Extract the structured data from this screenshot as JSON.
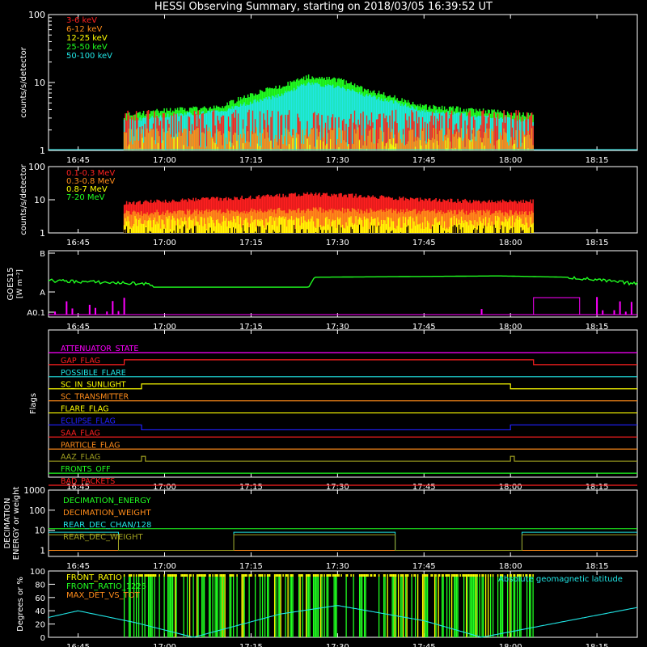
{
  "title": "HESSI Observing Summary, starting on 2018/03/05 16:39:52 UT",
  "x_ticks": [
    "16:45",
    "17:00",
    "17:15",
    "17:30",
    "17:45",
    "18:00",
    "18:15"
  ],
  "colors": {
    "text": "#ffffff",
    "axis": "#ffffff",
    "red": "#ff2020",
    "orange": "#ff8c1a",
    "yellow": "#ffff00",
    "green": "#20ff20",
    "cyan": "#20e6e6",
    "magenta": "#ff00ff",
    "blue": "#2020ff",
    "olive": "#a0a020",
    "gold": "#ffcc33"
  },
  "chart_data": [
    {
      "id": "low-energy",
      "type": "line",
      "ylabel": "counts/s/detector",
      "y_scale": "log",
      "ylim": [
        1,
        100
      ],
      "y_ticks": [
        "1",
        "10",
        "100"
      ],
      "xlim": [
        "16:39:52",
        "18:22"
      ],
      "legend": [
        "3-6 keV",
        "6-12 keV",
        "12-25 keV",
        "25-50 keV",
        "50-100 keV"
      ],
      "legend_colors": [
        "#ff2020",
        "#ff8c1a",
        "#ffff00",
        "#20ff20",
        "#20e6e6"
      ],
      "observation_window": [
        "16:53",
        "18:04"
      ],
      "series": [
        {
          "x": [
            "16:53",
            "17:00",
            "17:10",
            "17:20",
            "17:25",
            "17:30",
            "17:35",
            "17:45",
            "17:55",
            "18:04"
          ],
          "y": [
            3,
            3.5,
            4,
            8,
            11,
            10,
            7,
            4,
            3.5,
            3
          ]
        },
        {
          "x": [
            "16:53",
            "17:00",
            "17:10",
            "17:20",
            "17:25",
            "17:30",
            "17:35",
            "17:45",
            "17:55",
            "18:04"
          ],
          "y": [
            2.5,
            3,
            3.5,
            6,
            9,
            8,
            6,
            3.5,
            3,
            2.5
          ]
        },
        {
          "x": [
            "16:53",
            "18:04"
          ],
          "y": [
            2,
            2
          ]
        }
      ]
    },
    {
      "id": "high-energy",
      "type": "line",
      "ylabel": "counts/s/detector",
      "y_scale": "log",
      "ylim": [
        1,
        100
      ],
      "y_ticks": [
        "1",
        "10",
        "100"
      ],
      "legend": [
        "0.1-0.3 MeV",
        "0.3-0.8 MeV",
        "0.8-7 MeV",
        "7-20 MeV"
      ],
      "legend_colors": [
        "#ff2020",
        "#ff8c1a",
        "#ffff00",
        "#20ff20"
      ],
      "series": [
        {
          "x": [
            "16:53",
            "17:05",
            "17:15",
            "17:25",
            "17:35",
            "17:45",
            "17:55",
            "18:04"
          ],
          "y": [
            8,
            10,
            12,
            15,
            13,
            10,
            9,
            9
          ]
        },
        {
          "x": [
            "16:53",
            "17:25",
            "18:04"
          ],
          "y": [
            4,
            5,
            4
          ]
        },
        {
          "x": [
            "16:53",
            "18:04"
          ],
          "y": [
            2,
            2
          ]
        }
      ]
    },
    {
      "id": "goes",
      "type": "line",
      "ylabel": "GOES15",
      "ylabel2": "[W m⁻²]",
      "y_ticks": [
        "A0.1",
        "A",
        "B"
      ],
      "series": [
        {
          "name": "GOES",
          "x": [
            "16:39:52",
            "16:57",
            "16:58",
            "17:25",
            "17:26",
            "17:58",
            "18:10",
            "18:22"
          ],
          "y": [
            0.55,
            0.5,
            0.45,
            0.45,
            0.6,
            0.62,
            0.6,
            0.5
          ]
        }
      ]
    },
    {
      "id": "flags",
      "type": "table",
      "ylabel": "Flags",
      "rows": [
        {
          "label": "ATTENUATOR_STATE",
          "color": "#ff00ff",
          "steps": []
        },
        {
          "label": "GAP_FLAG",
          "color": "#ff2020",
          "steps": [
            [
              "16:53",
              1
            ],
            [
              "18:04",
              0
            ]
          ]
        },
        {
          "label": "POSSIBLE_FLARE",
          "color": "#20e6e6",
          "steps": []
        },
        {
          "label": "SC_IN_SUNLIGHT",
          "color": "#ffff00",
          "steps": [
            [
              "16:56",
              1
            ],
            [
              "18:00",
              0
            ]
          ]
        },
        {
          "label": "SC_TRANSMITTER",
          "color": "#ff8c1a",
          "steps": []
        },
        {
          "label": "FLARE_FLAG",
          "color": "#ffff00",
          "steps": []
        },
        {
          "label": "ECLIPSE_FLAG",
          "color": "#2020ff",
          "steps": [
            [
              "16:56",
              -1
            ],
            [
              "18:00",
              0
            ]
          ]
        },
        {
          "label": "SAA_FLAG",
          "color": "#ff2020",
          "steps": []
        },
        {
          "label": "PARTICLE_FLAG",
          "color": "#ff8c1a",
          "steps": []
        },
        {
          "label": "AAZ_FLAG",
          "color": "#a0a020",
          "steps": [
            [
              "16:56",
              1
            ],
            [
              "16:56:40",
              0
            ],
            [
              "18:00",
              1
            ],
            [
              "18:00:40",
              0
            ]
          ]
        },
        {
          "label": "FRONTS_OFF",
          "color": "#20ff20",
          "steps": []
        },
        {
          "label": "BAD_PACKETS",
          "color": "#ff2020",
          "steps": []
        }
      ]
    },
    {
      "id": "decimation",
      "type": "line",
      "ylabel": "DECIMATION",
      "ylabel2": "ENERGY or weight",
      "y_scale": "log",
      "ylim": [
        0.5,
        1000
      ],
      "y_ticks": [
        "1",
        "10",
        "100",
        "1000"
      ],
      "legend": [
        "DECIMATION_ENERGY",
        "DECIMATION_WEIGHT",
        "REAR_DEC_CHAN/128",
        "REAR_DEC_WEIGHT"
      ],
      "legend_colors": [
        "#20ff20",
        "#ff8c1a",
        "#20e6e6",
        "#a0a020"
      ],
      "series": [
        {
          "name": "DECIMATION_ENERGY",
          "x": [
            "16:39:52",
            "18:22"
          ],
          "y": [
            12,
            12
          ]
        },
        {
          "name": "DECIMATION_WEIGHT",
          "x": [
            "16:39:52",
            "18:22"
          ],
          "y": [
            1,
            1
          ]
        },
        {
          "name": "REAR_DEC_CHAN/128",
          "x": [
            "16:39:52",
            "16:52",
            "17:12",
            "17:40",
            "18:02",
            "18:22"
          ],
          "y": [
            8,
            1,
            8,
            1,
            8,
            8
          ]
        },
        {
          "name": "REAR_DEC_WEIGHT",
          "x": [
            "16:39:52",
            "16:52",
            "17:12",
            "17:40",
            "18:02",
            "18:22"
          ],
          "y": [
            6,
            1,
            6,
            1,
            6,
            6
          ]
        }
      ]
    },
    {
      "id": "ratios",
      "type": "line",
      "ylabel": "Degrees or %",
      "ylim": [
        0,
        100
      ],
      "y_ticks": [
        "0",
        "20",
        "40",
        "60",
        "80",
        "100"
      ],
      "legend": [
        "FRONT_RATIO",
        "FRONT_RATIO_1225",
        "MAX_DET_VS_TOT"
      ],
      "legend_colors": [
        "#ffff00",
        "#20ff20",
        "#ff8c1a"
      ],
      "annotation": "Absolute geomagnetic latitude",
      "annotation_color": "#20e6e6",
      "series": [
        {
          "name": "Absolute geomagnetic latitude",
          "x": [
            "16:39:52",
            "16:45",
            "16:55",
            "17:05",
            "17:20",
            "17:30",
            "17:45",
            "17:55",
            "18:10",
            "18:22"
          ],
          "y": [
            30,
            40,
            22,
            0,
            35,
            48,
            25,
            0,
            25,
            45
          ]
        }
      ]
    }
  ]
}
